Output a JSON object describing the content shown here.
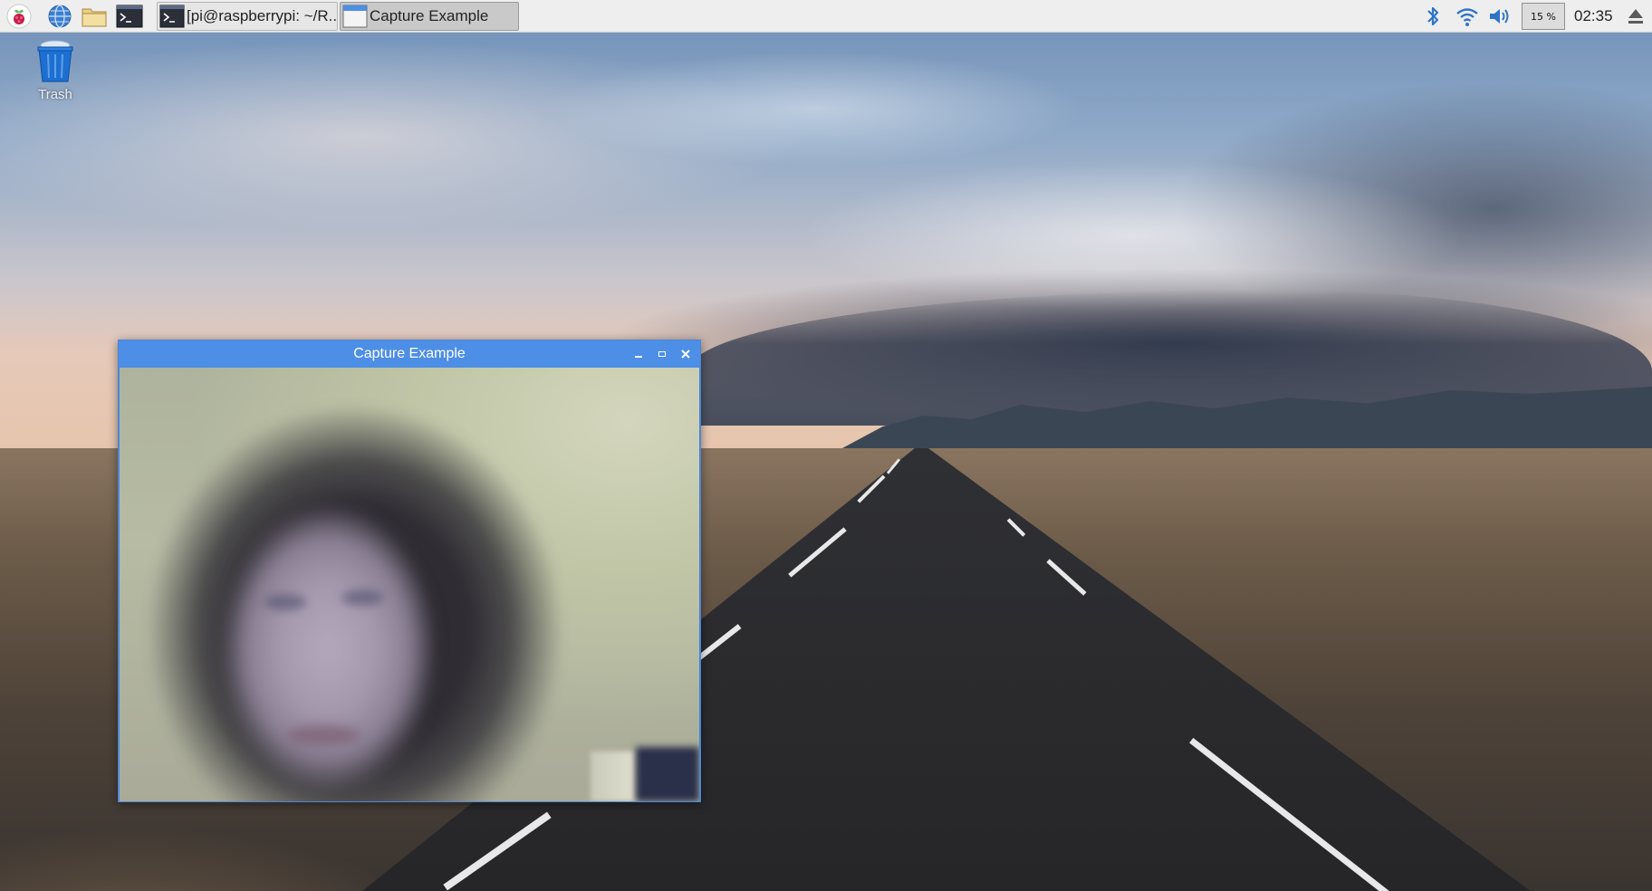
{
  "panel": {
    "menu_icon": "raspberry-pi-icon",
    "launchers": [
      {
        "name": "web-browser-icon"
      },
      {
        "name": "file-manager-icon"
      },
      {
        "name": "terminal-icon"
      }
    ],
    "tasks": [
      {
        "label": "[pi@raspberrypi: ~/R...",
        "icon": "terminal-icon",
        "active": false
      },
      {
        "label": "Capture Example",
        "icon": "window-icon",
        "active": true
      }
    ],
    "tray": {
      "bluetooth_icon": "bluetooth-icon",
      "wifi_icon": "wifi-icon",
      "volume_icon": "volume-icon",
      "cpu_label": "15 %",
      "clock": "02:35",
      "eject_icon": "eject-icon"
    }
  },
  "desktop": {
    "trash_label": "Trash"
  },
  "window": {
    "title": "Capture Example",
    "controls": {
      "minimize": "_",
      "maximize": "□",
      "close": "✕"
    }
  },
  "colors": {
    "panel_bg": "#eeeeee",
    "titlebar": "#4d8ee6",
    "taskbar_active": "#c9c9c9"
  }
}
